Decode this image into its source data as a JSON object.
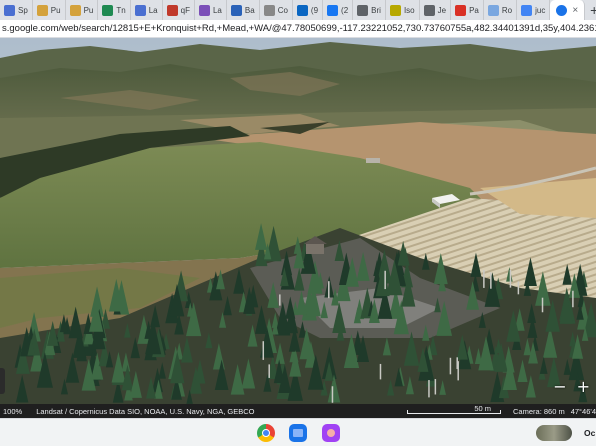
{
  "tabs": [
    {
      "label": "Sp",
      "color": "#4a6fd1"
    },
    {
      "label": "Pu",
      "color": "#d4a23c"
    },
    {
      "label": "Pu",
      "color": "#d4a23c"
    },
    {
      "label": "Tn",
      "color": "#1f8a52"
    },
    {
      "label": "La",
      "color": "#4a6fd1"
    },
    {
      "label": "qF",
      "color": "#c0392b"
    },
    {
      "label": "La",
      "color": "#7b4fb8"
    },
    {
      "label": "Ba",
      "color": "#2a62b8"
    },
    {
      "label": "Co",
      "color": "#888888"
    },
    {
      "label": "(9",
      "color": "#0a66c2"
    },
    {
      "label": "(2",
      "color": "#1877f2"
    },
    {
      "label": "Bri",
      "color": "#5f6368"
    },
    {
      "label": "Iso",
      "color": "#b7a800"
    },
    {
      "label": "Je",
      "color": "#5f6368"
    },
    {
      "label": "Pa",
      "color": "#d93025"
    },
    {
      "label": "Ro",
      "color": "#7aa7e0"
    },
    {
      "label": "juc",
      "color": "#4285f4"
    }
  ],
  "active_tab": {
    "label": "",
    "color": "#1a73e8"
  },
  "address": {
    "url": "s.google.com/web/search/12815+E+Kronquist+Rd,+Mead,+WA/@47.78050699,-117.23221052,730.73760755a,482.34401391d,35y,404.23610154h,74.4982"
  },
  "statusbar": {
    "zoom": "100%",
    "attribution": "Landsat / Copernicus  Data SIO, NOAA, U.S. Navy, NGA, GEBCO",
    "scale": "50 m",
    "camera": "Camera: 860 m",
    "coords": "47°46'4"
  },
  "shelf": {
    "date": "Oc"
  },
  "controls": {
    "zoom_out": "−",
    "zoom_in": "+",
    "new_tab": "+",
    "close": "×"
  }
}
